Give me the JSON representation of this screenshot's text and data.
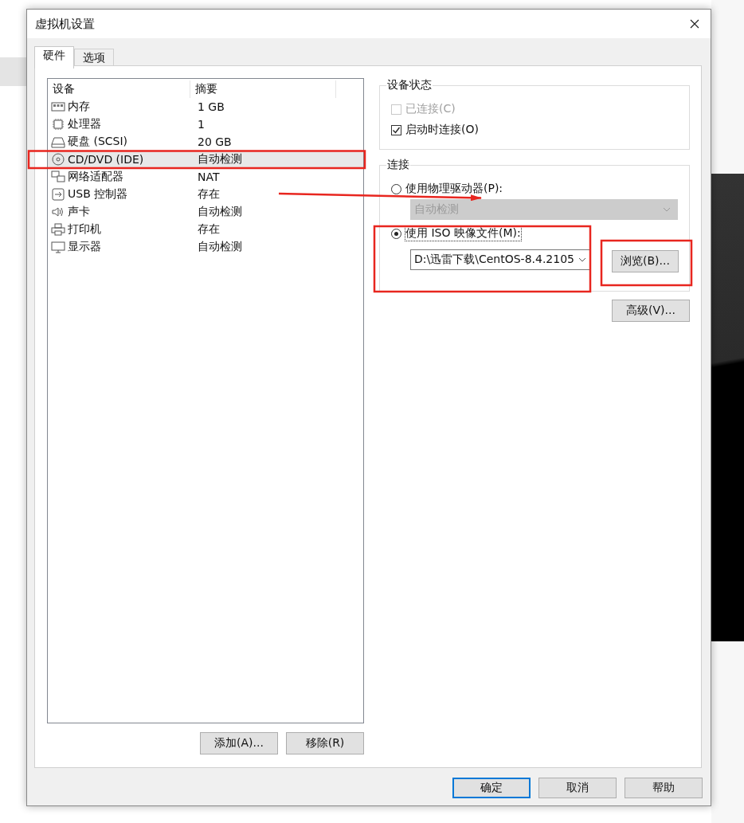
{
  "window": {
    "title": "虚拟机设置"
  },
  "tabs": [
    {
      "label": "硬件",
      "selected": true
    },
    {
      "label": "选项",
      "selected": false
    }
  ],
  "device_list": {
    "columns": [
      "设备",
      "摘要"
    ],
    "rows": [
      {
        "kind": "memory",
        "device": "内存",
        "summary": "1 GB",
        "selected": false
      },
      {
        "kind": "cpu",
        "device": "处理器",
        "summary": "1",
        "selected": false
      },
      {
        "kind": "disk",
        "device": "硬盘 (SCSI)",
        "summary": "20 GB",
        "selected": false
      },
      {
        "kind": "cdrom",
        "device": "CD/DVD (IDE)",
        "summary": "自动检测",
        "selected": true
      },
      {
        "kind": "network",
        "device": "网络适配器",
        "summary": "NAT",
        "selected": false
      },
      {
        "kind": "usb",
        "device": "USB 控制器",
        "summary": "存在",
        "selected": false
      },
      {
        "kind": "sound",
        "device": "声卡",
        "summary": "自动检测",
        "selected": false
      },
      {
        "kind": "printer",
        "device": "打印机",
        "summary": "存在",
        "selected": false
      },
      {
        "kind": "display",
        "device": "显示器",
        "summary": "自动检测",
        "selected": false
      }
    ]
  },
  "list_buttons": [
    "添加(A)...",
    "移除(R)"
  ],
  "device_status": {
    "title": "设备状态",
    "checkboxes": [
      {
        "label": "已连接(C)",
        "checked": false,
        "disabled": true
      },
      {
        "label": "启动时连接(O)",
        "checked": true,
        "disabled": false
      }
    ]
  },
  "connection": {
    "title": "连接",
    "options": [
      {
        "kind": "physical",
        "label": "使用物理驱动器(P):",
        "selected": false,
        "dropdown": {
          "value": "自动检测",
          "disabled": true
        }
      },
      {
        "kind": "iso",
        "label": "使用 ISO 映像文件(M):",
        "selected": true,
        "path": "D:\\迅雷下载\\CentOS-8.4.2105",
        "browse": "浏览(B)..."
      }
    ]
  },
  "advanced_button": "高级(V)...",
  "footer_buttons": [
    {
      "label": "确定",
      "default": true
    },
    {
      "label": "取消",
      "default": false
    },
    {
      "label": "帮助",
      "default": false
    }
  ]
}
